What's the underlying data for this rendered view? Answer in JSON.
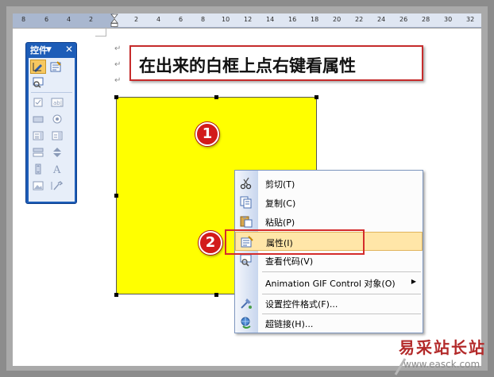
{
  "ruler": {
    "labels": [
      "8",
      "6",
      "4",
      "2",
      "2",
      "4",
      "6",
      "8",
      "10",
      "12",
      "14",
      "16",
      "18",
      "20",
      "22",
      "24",
      "26",
      "28",
      "30",
      "32"
    ]
  },
  "toolbox": {
    "title": "控件",
    "dropdown_glyph": "▼",
    "close_glyph": "✕",
    "tools": [
      "design-mode-icon",
      "properties-icon",
      "view-code-icon",
      "checkbox-icon",
      "textbox-icon",
      "command-button-icon",
      "option-button-icon",
      "listbox-icon",
      "combobox-icon",
      "toggle-button-icon",
      "spin-button-icon",
      "scrollbar-icon",
      "label-icon",
      "image-icon",
      "more-controls-icon"
    ]
  },
  "callout": {
    "text": "在出来的白框上点右键看属性"
  },
  "badges": {
    "one": "1",
    "two": "2"
  },
  "context_menu": {
    "items": [
      {
        "label": "剪切(T)",
        "icon": "scissors-icon"
      },
      {
        "label": "复制(C)",
        "icon": "copy-icon"
      },
      {
        "label": "粘贴(P)",
        "icon": "paste-icon"
      },
      {
        "label": "属性(I)",
        "icon": "properties-icon",
        "highlighted": true
      },
      {
        "label": "查看代码(V)",
        "icon": "view-code-icon"
      },
      {
        "label": "Animation GIF Control 对象(O)",
        "submenu": true
      },
      {
        "label": "设置控件格式(F)...",
        "icon": "format-control-icon"
      },
      {
        "label": "超链接(H)...",
        "icon": "hyperlink-icon"
      }
    ],
    "submenu_glyph": "▶"
  },
  "colors": {
    "control_fill": "#ffff00",
    "badge": "#d21b1b",
    "callout_border": "#c62c2c",
    "menu_highlight": "#ffe6a8",
    "toolbox_title": "#1d5db8"
  },
  "watermark": {
    "cn": "易采站长站",
    "url": "www.easck.com"
  }
}
